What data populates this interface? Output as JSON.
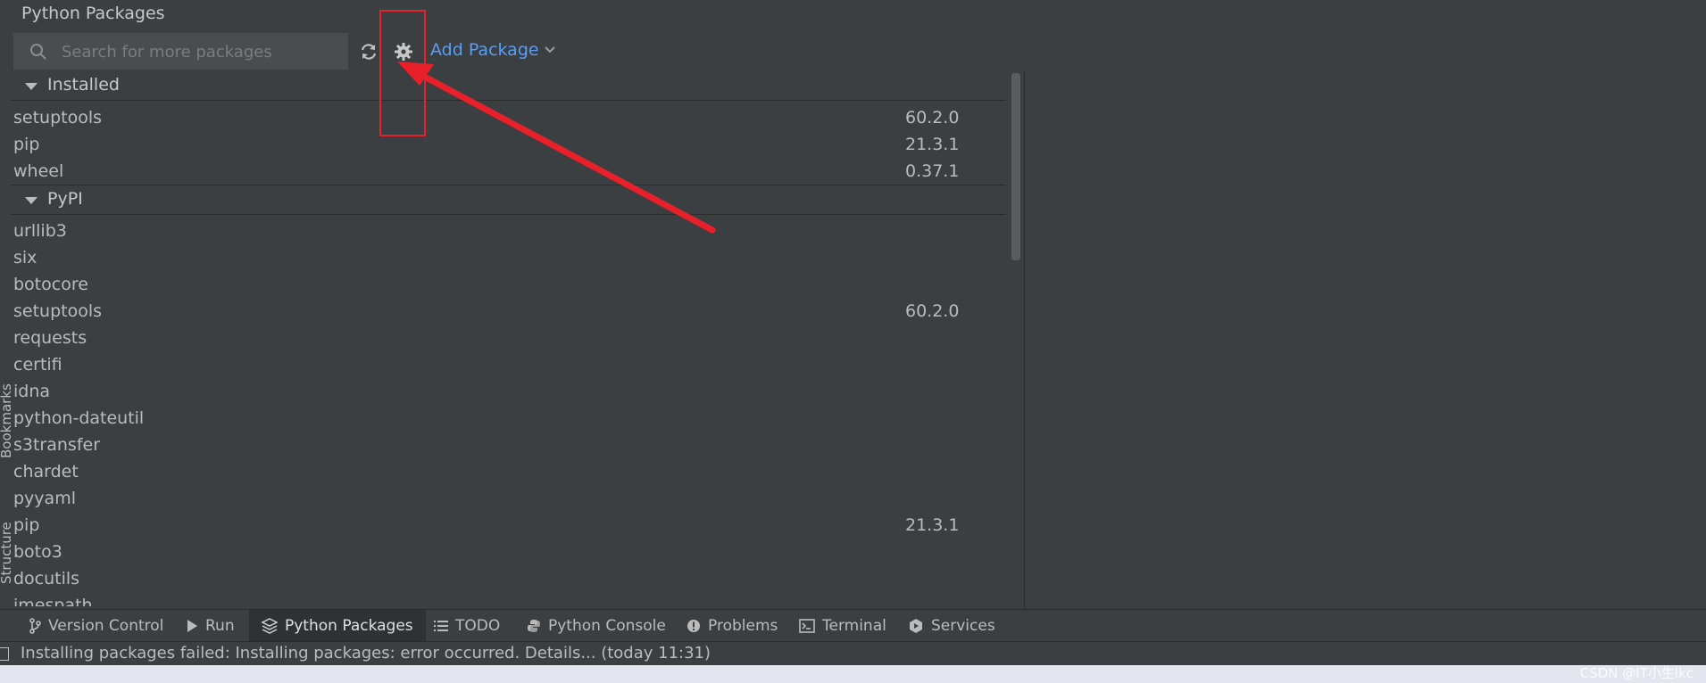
{
  "panel": {
    "title": "Python Packages"
  },
  "search": {
    "placeholder": "Search for more packages",
    "value": ""
  },
  "toolbar": {
    "add_package_label": "Add Package",
    "refresh_icon": "refresh-icon",
    "settings_icon": "gear-icon"
  },
  "groups": {
    "installed": {
      "label": "Installed",
      "packages": [
        {
          "name": "setuptools",
          "version": "60.2.0"
        },
        {
          "name": "pip",
          "version": "21.3.1"
        },
        {
          "name": "wheel",
          "version": "0.37.1"
        }
      ]
    },
    "pypi": {
      "label": "PyPI",
      "packages": [
        {
          "name": "urllib3",
          "version": ""
        },
        {
          "name": "six",
          "version": ""
        },
        {
          "name": "botocore",
          "version": ""
        },
        {
          "name": "setuptools",
          "version": "60.2.0"
        },
        {
          "name": "requests",
          "version": ""
        },
        {
          "name": "certifi",
          "version": ""
        },
        {
          "name": "idna",
          "version": ""
        },
        {
          "name": "python-dateutil",
          "version": ""
        },
        {
          "name": "s3transfer",
          "version": ""
        },
        {
          "name": "chardet",
          "version": ""
        },
        {
          "name": "pyyaml",
          "version": ""
        },
        {
          "name": "pip",
          "version": "21.3.1"
        },
        {
          "name": "boto3",
          "version": ""
        },
        {
          "name": "docutils",
          "version": ""
        },
        {
          "name": "jmespath",
          "version": ""
        }
      ]
    }
  },
  "side_tabs": {
    "bookmarks": "Bookmarks",
    "structure": "Structure"
  },
  "tool_tabs": [
    {
      "label": "Version Control",
      "icon": "branch-icon"
    },
    {
      "label": "Run",
      "icon": "play-icon"
    },
    {
      "label": "Python Packages",
      "icon": "layers-icon",
      "active": true
    },
    {
      "label": "TODO",
      "icon": "list-icon"
    },
    {
      "label": "Python Console",
      "icon": "python-icon"
    },
    {
      "label": "Problems",
      "icon": "warning-icon"
    },
    {
      "label": "Terminal",
      "icon": "terminal-icon"
    },
    {
      "label": "Services",
      "icon": "services-icon"
    }
  ],
  "status": {
    "message": "Installing packages failed: Installing packages: error occurred. Details... (today 11:31)"
  },
  "watermark": "CSDN @IT小生lkc",
  "colors": {
    "accent": "#589df6",
    "annotation": "#e8202a",
    "background": "#3c3f41"
  }
}
